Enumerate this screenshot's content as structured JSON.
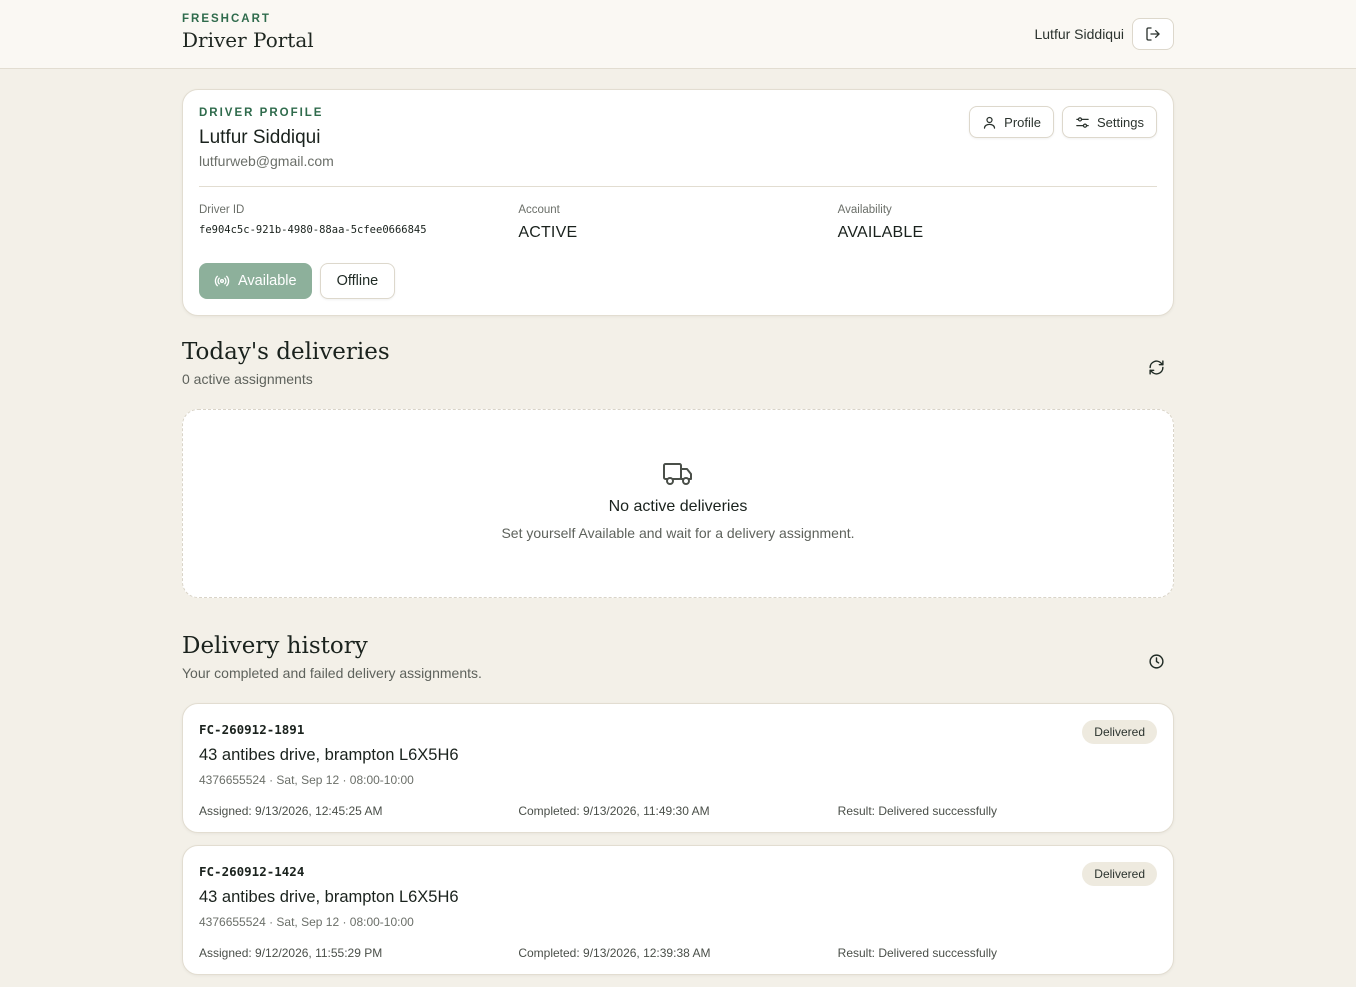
{
  "header": {
    "brand_kicker": "FRESHCART",
    "brand_title": "Driver Portal",
    "user_name": "Lutfur Siddiqui"
  },
  "profile": {
    "kicker": "DRIVER PROFILE",
    "name": "Lutfur Siddiqui",
    "email": "lutfurweb@gmail.com",
    "profile_button": "Profile",
    "settings_button": "Settings",
    "driver_id_label": "Driver ID",
    "driver_id": "fe904c5c-921b-4980-88aa-5cfee0666845",
    "account_label": "Account",
    "account_value": "ACTIVE",
    "availability_label": "Availability",
    "availability_value": "AVAILABLE",
    "available_button": "Available",
    "offline_button": "Offline"
  },
  "today": {
    "title": "Today's deliveries",
    "subtitle": "0 active assignments",
    "empty_title": "No active deliveries",
    "empty_subtitle": "Set yourself Available and wait for a delivery assignment."
  },
  "history": {
    "title": "Delivery history",
    "subtitle": "Your completed and failed delivery assignments.",
    "items": [
      {
        "order_id": "FC-260912-1891",
        "status": "Delivered",
        "address": "43 antibes drive, brampton L6X5H6",
        "meta": "4376655524 · Sat, Sep 12 · 08:00-10:00",
        "assigned": "Assigned: 9/13/2026, 12:45:25 AM",
        "completed": "Completed: 9/13/2026, 11:49:30 AM",
        "result": "Result: Delivered successfully"
      },
      {
        "order_id": "FC-260912-1424",
        "status": "Delivered",
        "address": "43 antibes drive, brampton L6X5H6",
        "meta": "4376655524 · Sat, Sep 12 · 08:00-10:00",
        "assigned": "Assigned: 9/12/2026, 11:55:29 PM",
        "completed": "Completed: 9/13/2026, 12:39:38 AM",
        "result": "Result: Delivered successfully"
      }
    ]
  },
  "colors": {
    "background": "#f3f0e8",
    "accent_green": "#2f6b4c",
    "available_button": "#8db09b",
    "badge_bg": "#eeeadf"
  },
  "icons": [
    "logout-icon",
    "user-icon",
    "sliders-icon",
    "broadcast-icon",
    "refresh-icon",
    "truck-icon",
    "clock-icon"
  ]
}
